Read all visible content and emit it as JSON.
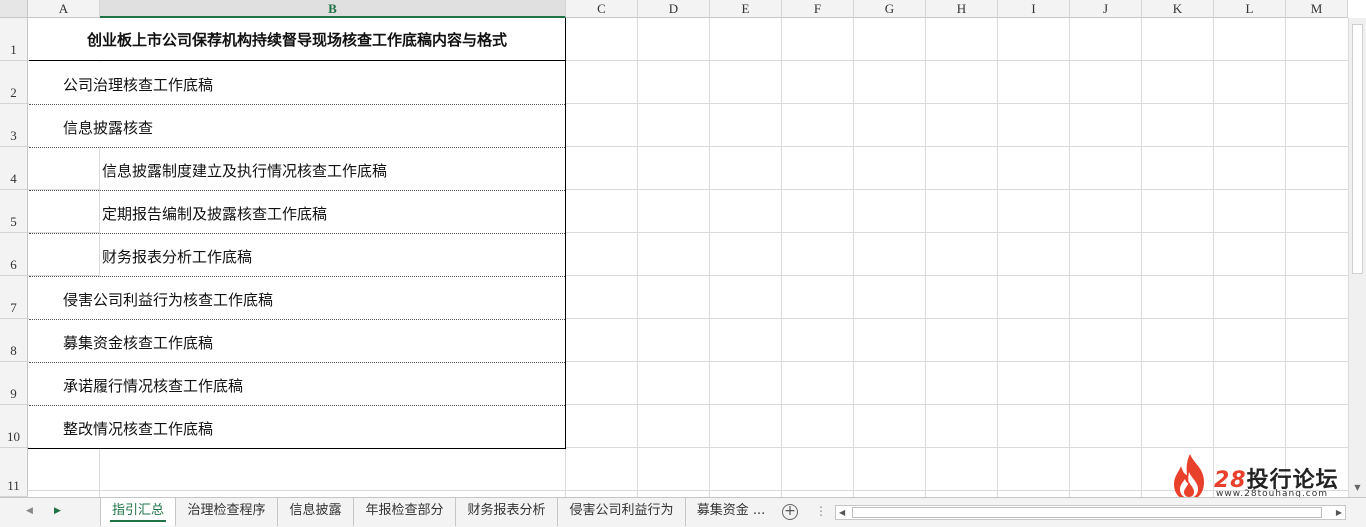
{
  "columns": [
    "A",
    "B",
    "C",
    "D",
    "E",
    "F",
    "G",
    "H",
    "I",
    "J",
    "K",
    "L",
    "M"
  ],
  "rows": [
    "1",
    "2",
    "3",
    "4",
    "5",
    "6",
    "7",
    "8",
    "9",
    "10",
    "11"
  ],
  "title": "创业板上市公司保荐机构持续督导现场核查工作底稿内容与格式",
  "entries": [
    "公司治理核查工作底稿",
    "信息披露核查",
    "信息披露制度建立及执行情况核查工作底稿",
    "定期报告编制及披露核查工作底稿",
    "财务报表分析工作底稿",
    "侵害公司利益行为核查工作底稿",
    "募集资金核查工作底稿",
    "承诺履行情况核查工作底稿",
    "整改情况核查工作底稿"
  ],
  "tabs": [
    "指引汇总",
    "治理检查程序",
    "信息披露",
    "年报检查部分",
    "财务报表分析",
    "侵害公司利益行为",
    "募集资金 ..."
  ],
  "tab_more": "⋮",
  "logo": {
    "brand_num": "28",
    "brand_text": "投行论坛",
    "url": "www.28touhang.com"
  }
}
